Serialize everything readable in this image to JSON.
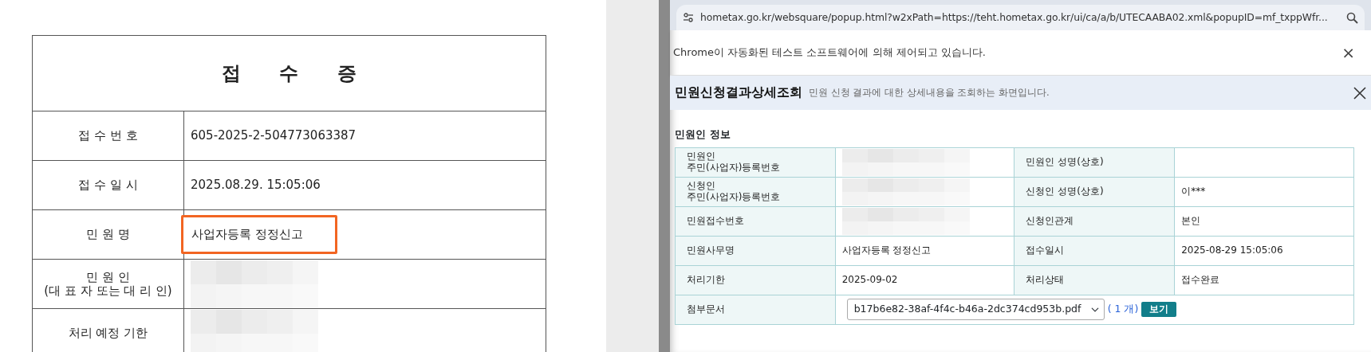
{
  "receipt": {
    "title": "접 수 증",
    "rows": [
      {
        "label": [
          "접 수 번 호"
        ],
        "value": "605-2025-2-504773063387",
        "highlighted": false,
        "redacted": false
      },
      {
        "label": [
          "접 수 일 시"
        ],
        "value": "2025.08.29. 15:05:06",
        "highlighted": false,
        "redacted": false
      },
      {
        "label": [
          "민 원 명"
        ],
        "value": "사업자등록 정정신고",
        "highlighted": true,
        "redacted": false
      },
      {
        "label": [
          "민 원 인",
          "(대 표 자 또는 대 리 인)"
        ],
        "highlighted": false,
        "redacted": true
      },
      {
        "label": [
          "처리 예정 기한"
        ],
        "highlighted": false,
        "redacted": true
      }
    ]
  },
  "browser": {
    "address": "hometax.go.kr/websquare/popup.html?w2xPath=https://teht.hometax.go.kr/ui/ca/a/b/UTECAABA02.xml&popupID=mf_txppWfr...",
    "infobar": "Chrome이 자동화된 테스트 소프트웨어에 의해 제어되고 있습니다.",
    "infobar_close": "×"
  },
  "popup": {
    "title": "민원신청결과상세조회",
    "subtitle": "민원 신청 결과에 대한 상세내용을 조회하는 화면입니다.",
    "section_title": "민원인 정보",
    "rows": [
      {
        "cells": [
          {
            "label": "민원인\n주민(사업자)등록번호",
            "redacted": true
          },
          {
            "label": "민원인 성명(상호)",
            "redacted": false
          }
        ]
      },
      {
        "cells": [
          {
            "label": "신청인\n주민(사업자)등록번호",
            "redacted": true
          },
          {
            "label": "신청인 성명(상호)",
            "value": "이***",
            "redacted": false
          }
        ]
      },
      {
        "cells": [
          {
            "label": "민원접수번호",
            "redacted": true
          },
          {
            "label": "신청인관계",
            "value": "본인",
            "redacted": false
          }
        ]
      },
      {
        "cells": [
          {
            "label": "민원사무명",
            "value": "사업자등록 정정신고",
            "redacted": false
          },
          {
            "label": "접수일시",
            "value": "2025-08-29 15:05:06",
            "redacted": false
          }
        ]
      },
      {
        "cells": [
          {
            "label": "처리기한",
            "value": "2025-09-02",
            "redacted": false
          },
          {
            "label": "처리상태",
            "value": "접수완료",
            "redacted": false
          }
        ]
      }
    ],
    "attachment": {
      "label": "첨부문서",
      "file": "b17b6e82-38af-4f4c-b46a-2dc374cd953b.pdf",
      "count": "( 1 개)",
      "button": "보기"
    }
  }
}
